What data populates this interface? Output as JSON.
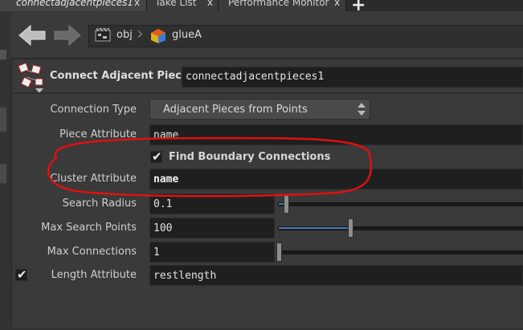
{
  "tabs": [
    {
      "label": "connectadjacentpieces1",
      "close": "x"
    },
    {
      "label": "Take List",
      "close": "x"
    },
    {
      "label": "Performance Monitor",
      "close": "x"
    }
  ],
  "add_tab_label": "+",
  "nav": {
    "path": [
      {
        "label": "obj",
        "icon": "network-icon"
      },
      {
        "label": "glueA",
        "icon": "geometry-node-icon"
      }
    ]
  },
  "node": {
    "type_label": "Connect Adjacent Pieces",
    "name": "connectadjacentpieces1",
    "icon": "connect-adjacent-pieces-icon"
  },
  "params": {
    "connection_type": {
      "label": "Connection Type",
      "value": "Adjacent Pieces from Points"
    },
    "piece_attribute": {
      "label": "Piece Attribute",
      "value": "name"
    },
    "find_boundary": {
      "label": "Find Boundary Connections",
      "checked": true
    },
    "cluster_attribute": {
      "label": "Cluster Attribute",
      "value": "name"
    },
    "search_radius": {
      "label": "Search Radius",
      "value": "0.1"
    },
    "max_search_points": {
      "label": "Max Search Points",
      "value": "100"
    },
    "max_connections": {
      "label": "Max Connections",
      "value": "1"
    },
    "length_attribute": {
      "label": "Length Attribute",
      "value": "restlength",
      "enabled": true
    }
  },
  "annotation": {
    "color": "#e01010"
  }
}
